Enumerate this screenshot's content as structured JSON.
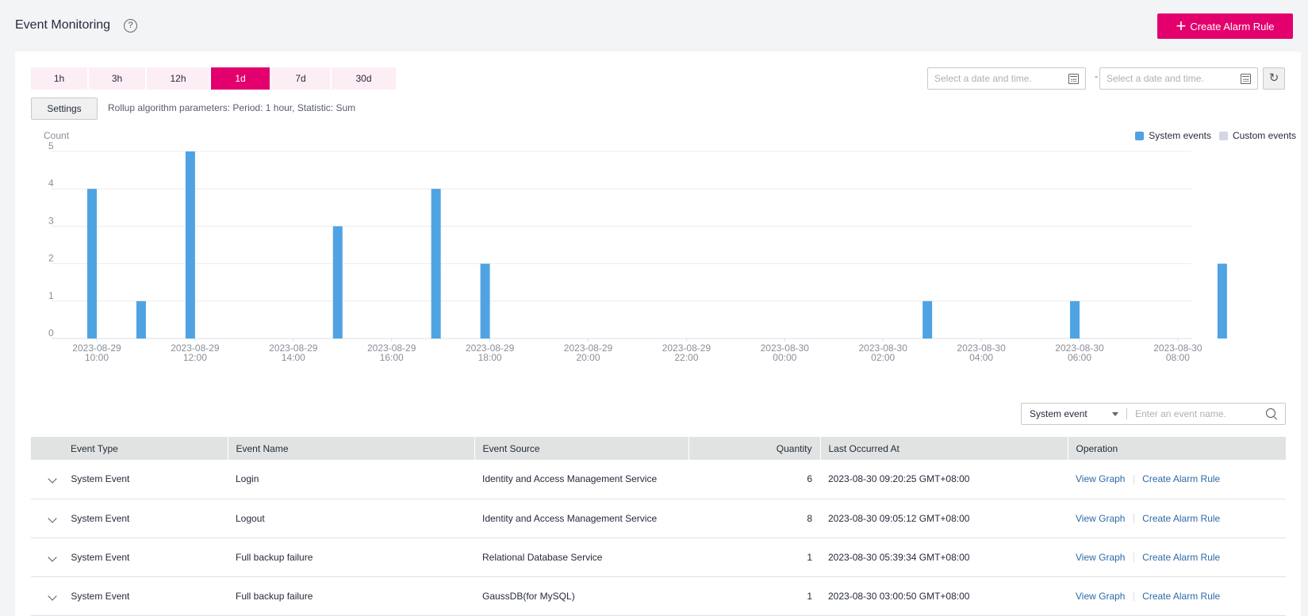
{
  "header": {
    "title": "Event Monitoring",
    "help_icon": "question-circle-icon",
    "create_button": "Create Alarm Rule"
  },
  "controls": {
    "range_tabs": [
      {
        "label": "1h",
        "active": false
      },
      {
        "label": "3h",
        "active": false
      },
      {
        "label": "12h",
        "active": false
      },
      {
        "label": "1d",
        "active": true
      },
      {
        "label": "7d",
        "active": false
      },
      {
        "label": "30d",
        "active": false
      }
    ],
    "settings_label": "Settings",
    "rollup_text": "Rollup algorithm parameters: Period: 1 hour, Statistic: Sum",
    "start_date_placeholder": "Select a date and time.",
    "end_date_placeholder": "Select a date and time.",
    "date_separator": "-",
    "refresh_icon": "refresh-icon"
  },
  "colors": {
    "accent": "#e3006e",
    "system_events": "#4fa3e3",
    "custom_events": "#d2d6e6",
    "link": "#2d6aa8"
  },
  "chart_data": {
    "type": "bar",
    "ylabel": "Count",
    "xlabel": "",
    "ylim": [
      0,
      5
    ],
    "yticks": [
      0,
      1,
      2,
      3,
      4,
      5
    ],
    "grid": true,
    "legend_position": "top-right",
    "x_range": [
      "2023-08-29 09:00",
      "2023-08-30 10:00"
    ],
    "x_tick_labels": [
      {
        "date": "2023-08-29",
        "time": "10:00"
      },
      {
        "date": "2023-08-29",
        "time": "12:00"
      },
      {
        "date": "2023-08-29",
        "time": "14:00"
      },
      {
        "date": "2023-08-29",
        "time": "16:00"
      },
      {
        "date": "2023-08-29",
        "time": "18:00"
      },
      {
        "date": "2023-08-29",
        "time": "20:00"
      },
      {
        "date": "2023-08-29",
        "time": "22:00"
      },
      {
        "date": "2023-08-30",
        "time": "00:00"
      },
      {
        "date": "2023-08-30",
        "time": "02:00"
      },
      {
        "date": "2023-08-30",
        "time": "04:00"
      },
      {
        "date": "2023-08-30",
        "time": "06:00"
      },
      {
        "date": "2023-08-30",
        "time": "08:00"
      }
    ],
    "series": [
      {
        "name": "System events",
        "points": [
          {
            "x": "2023-08-29 10:00",
            "value": 4
          },
          {
            "x": "2023-08-29 11:00",
            "value": 1
          },
          {
            "x": "2023-08-29 12:00",
            "value": 5
          },
          {
            "x": "2023-08-29 15:00",
            "value": 3
          },
          {
            "x": "2023-08-29 17:00",
            "value": 4
          },
          {
            "x": "2023-08-29 18:00",
            "value": 2
          },
          {
            "x": "2023-08-30 03:00",
            "value": 1
          },
          {
            "x": "2023-08-30 06:00",
            "value": 1
          },
          {
            "x": "2023-08-30 09:00",
            "value": 2
          }
        ]
      },
      {
        "name": "Custom events",
        "points": []
      }
    ]
  },
  "filter": {
    "type_selected": "System event",
    "search_placeholder": "Enter an event name."
  },
  "table": {
    "columns": [
      "Event Type",
      "Event Name",
      "Event Source",
      "Quantity",
      "Last Occurred At",
      "Operation"
    ],
    "rows": [
      {
        "type": "System Event",
        "name": "Login",
        "source": "Identity and Access Management Service",
        "quantity": "6",
        "last": "2023-08-30 09:20:25 GMT+08:00"
      },
      {
        "type": "System Event",
        "name": "Logout",
        "source": "Identity and Access Management Service",
        "quantity": "8",
        "last": "2023-08-30 09:05:12 GMT+08:00"
      },
      {
        "type": "System Event",
        "name": "Full backup failure",
        "source": "Relational Database Service",
        "quantity": "1",
        "last": "2023-08-30 05:39:34 GMT+08:00"
      },
      {
        "type": "System Event",
        "name": "Full backup failure",
        "source": "GaussDB(for MySQL)",
        "quantity": "1",
        "last": "2023-08-30 03:00:50 GMT+08:00"
      }
    ],
    "operations": {
      "view_graph": "View Graph",
      "create_alarm": "Create Alarm Rule"
    }
  }
}
